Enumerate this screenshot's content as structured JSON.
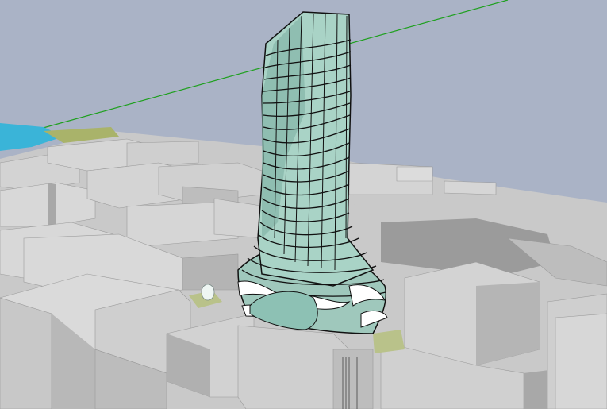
{
  "viewport": {
    "sky_color": "#aab3c6",
    "ground_color": "#c9c9c9",
    "building_colors": {
      "top": "#d6d6d6",
      "side_light": "#bdbdbd",
      "side_dark": "#9e9e9e",
      "edge": "#8a8a8a"
    },
    "tower_colors": {
      "glass": "#a9d3c6",
      "glass_dark": "#7fb0a4",
      "fins": "#ffffff",
      "outline": "#111111"
    },
    "water_color": "#3ab4d8",
    "park_color": "#a9b36a",
    "axis_line_color": "#1ea01e"
  }
}
